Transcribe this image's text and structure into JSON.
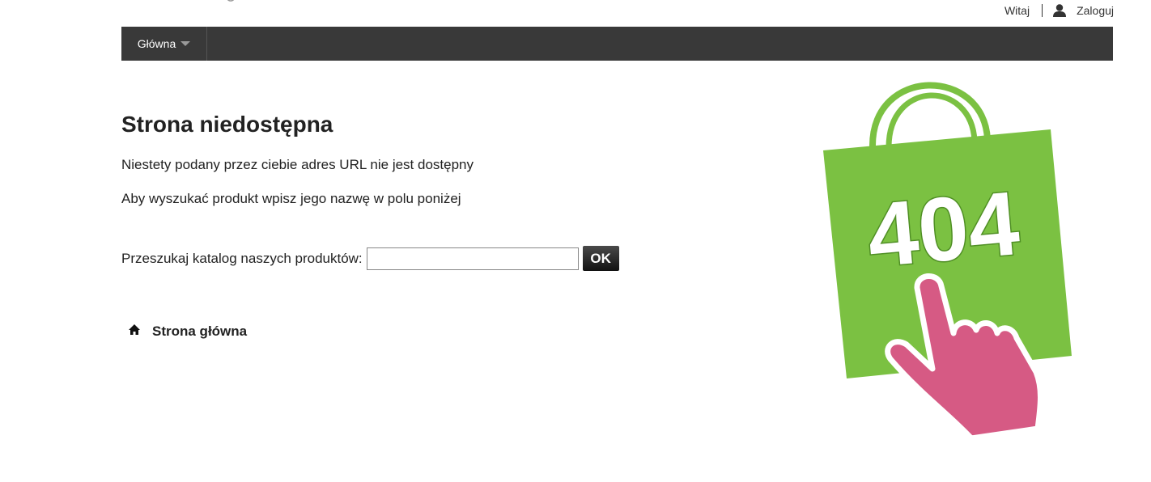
{
  "header": {
    "welcome": "Witaj",
    "login": "Zaloguj",
    "user_icon": "user-icon"
  },
  "nav": {
    "items": [
      {
        "label": "Główna",
        "icon": "caret-down-icon"
      }
    ]
  },
  "main": {
    "title": "Strona niedostępna",
    "message_1": "Niestety podany przez ciebie adres URL nie jest dostępny",
    "message_2": "Aby wyszukać produkt wpisz jego nazwę w polu poniżej",
    "search": {
      "label": "Przeszukaj katalog naszych produktów:",
      "value": "",
      "button": "OK"
    },
    "home_link": {
      "label": "Strona główna",
      "icon": "home-icon"
    }
  },
  "illustration": {
    "code": "404",
    "bag_color": "#7bc142",
    "hand_color": "#d65a84"
  },
  "colors": {
    "navbar": "#393939",
    "text": "#222222"
  }
}
